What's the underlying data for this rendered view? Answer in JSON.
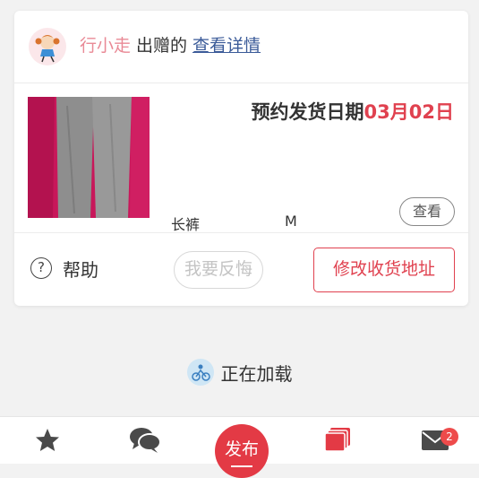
{
  "header": {
    "user_name": "行小走",
    "action_text": "出赠的",
    "details_link": "查看详情"
  },
  "item": {
    "ship_date_label": "预约发货日期",
    "ship_date_value": "03月02日",
    "name": "长裤",
    "size": "M",
    "view_button": "查看"
  },
  "footer": {
    "help_label": "帮助",
    "regret_button": "我要反悔",
    "change_address_button": "修改收货地址"
  },
  "loading": {
    "text": "正在加载"
  },
  "tabbar": {
    "items": [
      {
        "icon": "star-icon"
      },
      {
        "icon": "chat-bubbles-icon"
      },
      {
        "icon": "publish-icon",
        "label": "发布"
      },
      {
        "icon": "stacked-cards-icon"
      },
      {
        "icon": "mail-icon",
        "badge": "2"
      }
    ]
  },
  "colors": {
    "accent": "#e0414f",
    "user_name": "#e98a96",
    "link": "#3a5a98",
    "tab_icon": "#444444"
  }
}
